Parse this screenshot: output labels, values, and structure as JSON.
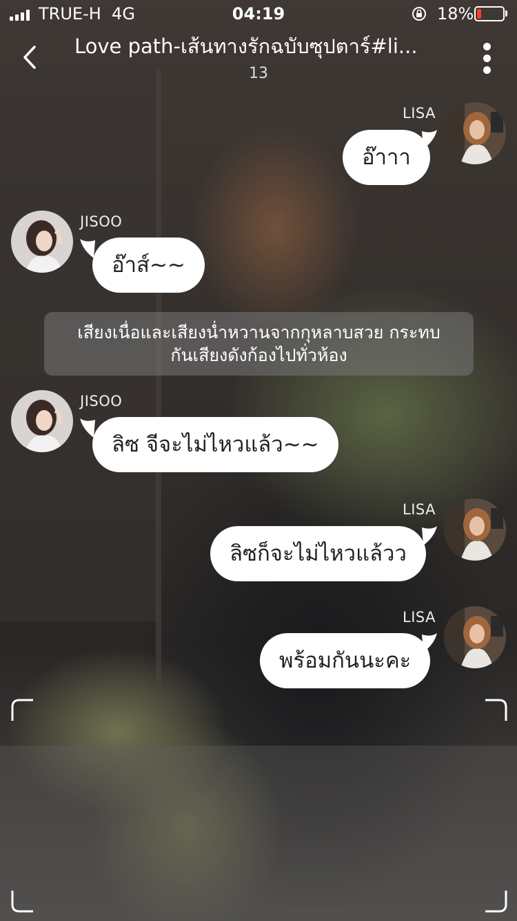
{
  "status_bar": {
    "carrier": "TRUE-H",
    "network": "4G",
    "time": "04:19",
    "battery_percent": "18%",
    "battery_level": 0.18,
    "battery_color": "#ff3b30"
  },
  "header": {
    "title": "Love path-เส้นทางรักฉบับซุปตาร์#li...",
    "episode_count": "13"
  },
  "messages": [
    {
      "sender": "LISA",
      "side": "right",
      "text": "อ๊าาา"
    },
    {
      "sender": "JISOO",
      "side": "left",
      "text": "อ๊าส์~~"
    },
    {
      "type": "narration",
      "line1": "เสียงเนื่อและเสียงน่ำหวานจากกุหลาบสวย กระทบ",
      "line2": "กันเสียงดังก้องไปทั่วห้อง"
    },
    {
      "sender": "JISOO",
      "side": "left",
      "text": "ลิซ จีจะไม่ไหวแล้ว~~"
    },
    {
      "sender": "LISA",
      "side": "right",
      "text": "ลิซก็จะไม่ไหวแล้วว"
    },
    {
      "sender": "LISA",
      "side": "right",
      "text": "พร้อมกันนะคะ"
    }
  ],
  "icons": {
    "back": "chevron-left-icon",
    "more": "more-vertical-icon",
    "lock": "rotation-lock-icon"
  }
}
